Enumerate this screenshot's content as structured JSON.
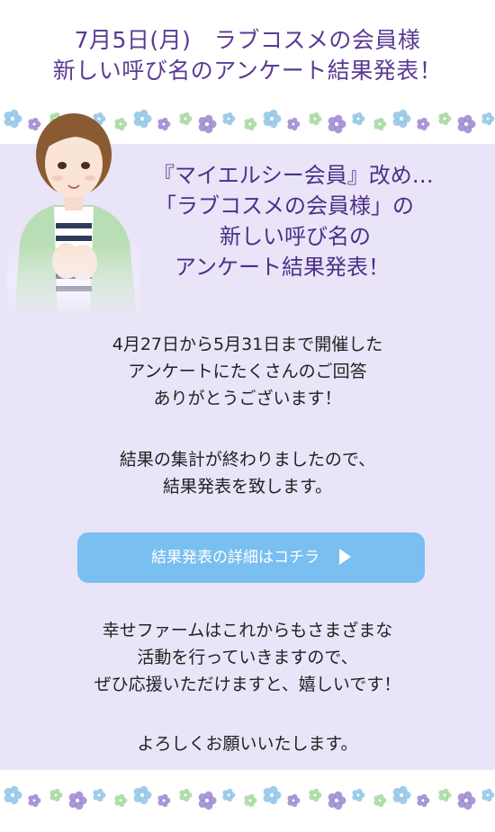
{
  "header": {
    "line1": "7月5日(月)　ラブコスメの会員様",
    "line2": "新しい呼び名のアンケート結果発表！"
  },
  "intro": {
    "lines": [
      "『マイエルシー会員』改め…",
      "「ラブコスメの会員様」の",
      "新しい呼び名の",
      "アンケート結果発表！"
    ]
  },
  "body": {
    "para1": [
      "4月27日から5月31日まで開催した",
      "アンケートにたくさんのご回答",
      "ありがとうございます！"
    ],
    "para2": [
      "結果の集計が終わりましたので、",
      "結果発表を致します。"
    ],
    "para3": [
      "幸せファームはこれからもさまざまな",
      "活動を行っていきますので、",
      "ぜひ応援いただけますと、嬉しいです！"
    ],
    "para4": [
      "よろしくお願いいたします。"
    ]
  },
  "cta": {
    "label": "結果発表の詳細はコチラ",
    "icon": "play-arrow-icon"
  },
  "colors": {
    "header_text": "#5b3a93",
    "intro_text": "#4c2f86",
    "panel_bg": "#e9e4f8",
    "cta_bg": "#79bff0",
    "flower_purple": "#9c86cf",
    "flower_blue": "#8fc4e6",
    "flower_green": "#a6d7a0"
  }
}
